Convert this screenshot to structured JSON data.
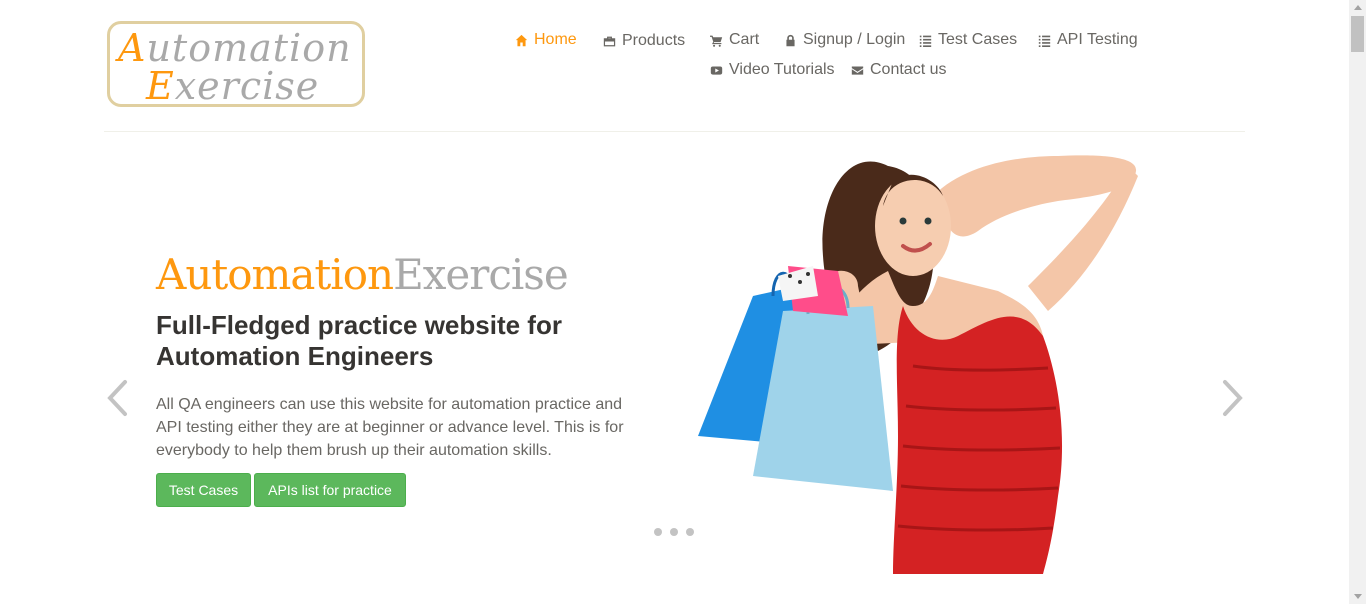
{
  "logo": {
    "line1_cap": "A",
    "line1_rest": "utomation",
    "line2_cap": "E",
    "line2_rest": "xercise"
  },
  "nav": {
    "items": [
      {
        "label": "Home",
        "icon": "home-icon",
        "active": true
      },
      {
        "label": "Products",
        "icon": "products-icon"
      },
      {
        "label": "Cart",
        "icon": "cart-icon"
      },
      {
        "label": "Signup / Login",
        "icon": "lock-icon"
      },
      {
        "label": "Test Cases",
        "icon": "list-icon"
      },
      {
        "label": "API Testing",
        "icon": "list-icon"
      },
      {
        "label": "Video Tutorials",
        "icon": "youtube-icon"
      },
      {
        "label": "Contact us",
        "icon": "envelope-icon"
      }
    ]
  },
  "slider": {
    "brand_part1": "Automation",
    "brand_part2": "Exercise",
    "headline": "Full-Fledged practice website for Automation Engineers",
    "description": "All QA engineers can use this website for automation practice and API testing either they are at beginner or advance level. This is for everybody to help them brush up their automation skills.",
    "button_test_cases": "Test Cases",
    "button_apis": "APIs list for practice",
    "slide_count": 3
  },
  "colors": {
    "accent": "#fe980f",
    "button": "#5cb85c",
    "text": "#696763",
    "heading": "#363432"
  }
}
